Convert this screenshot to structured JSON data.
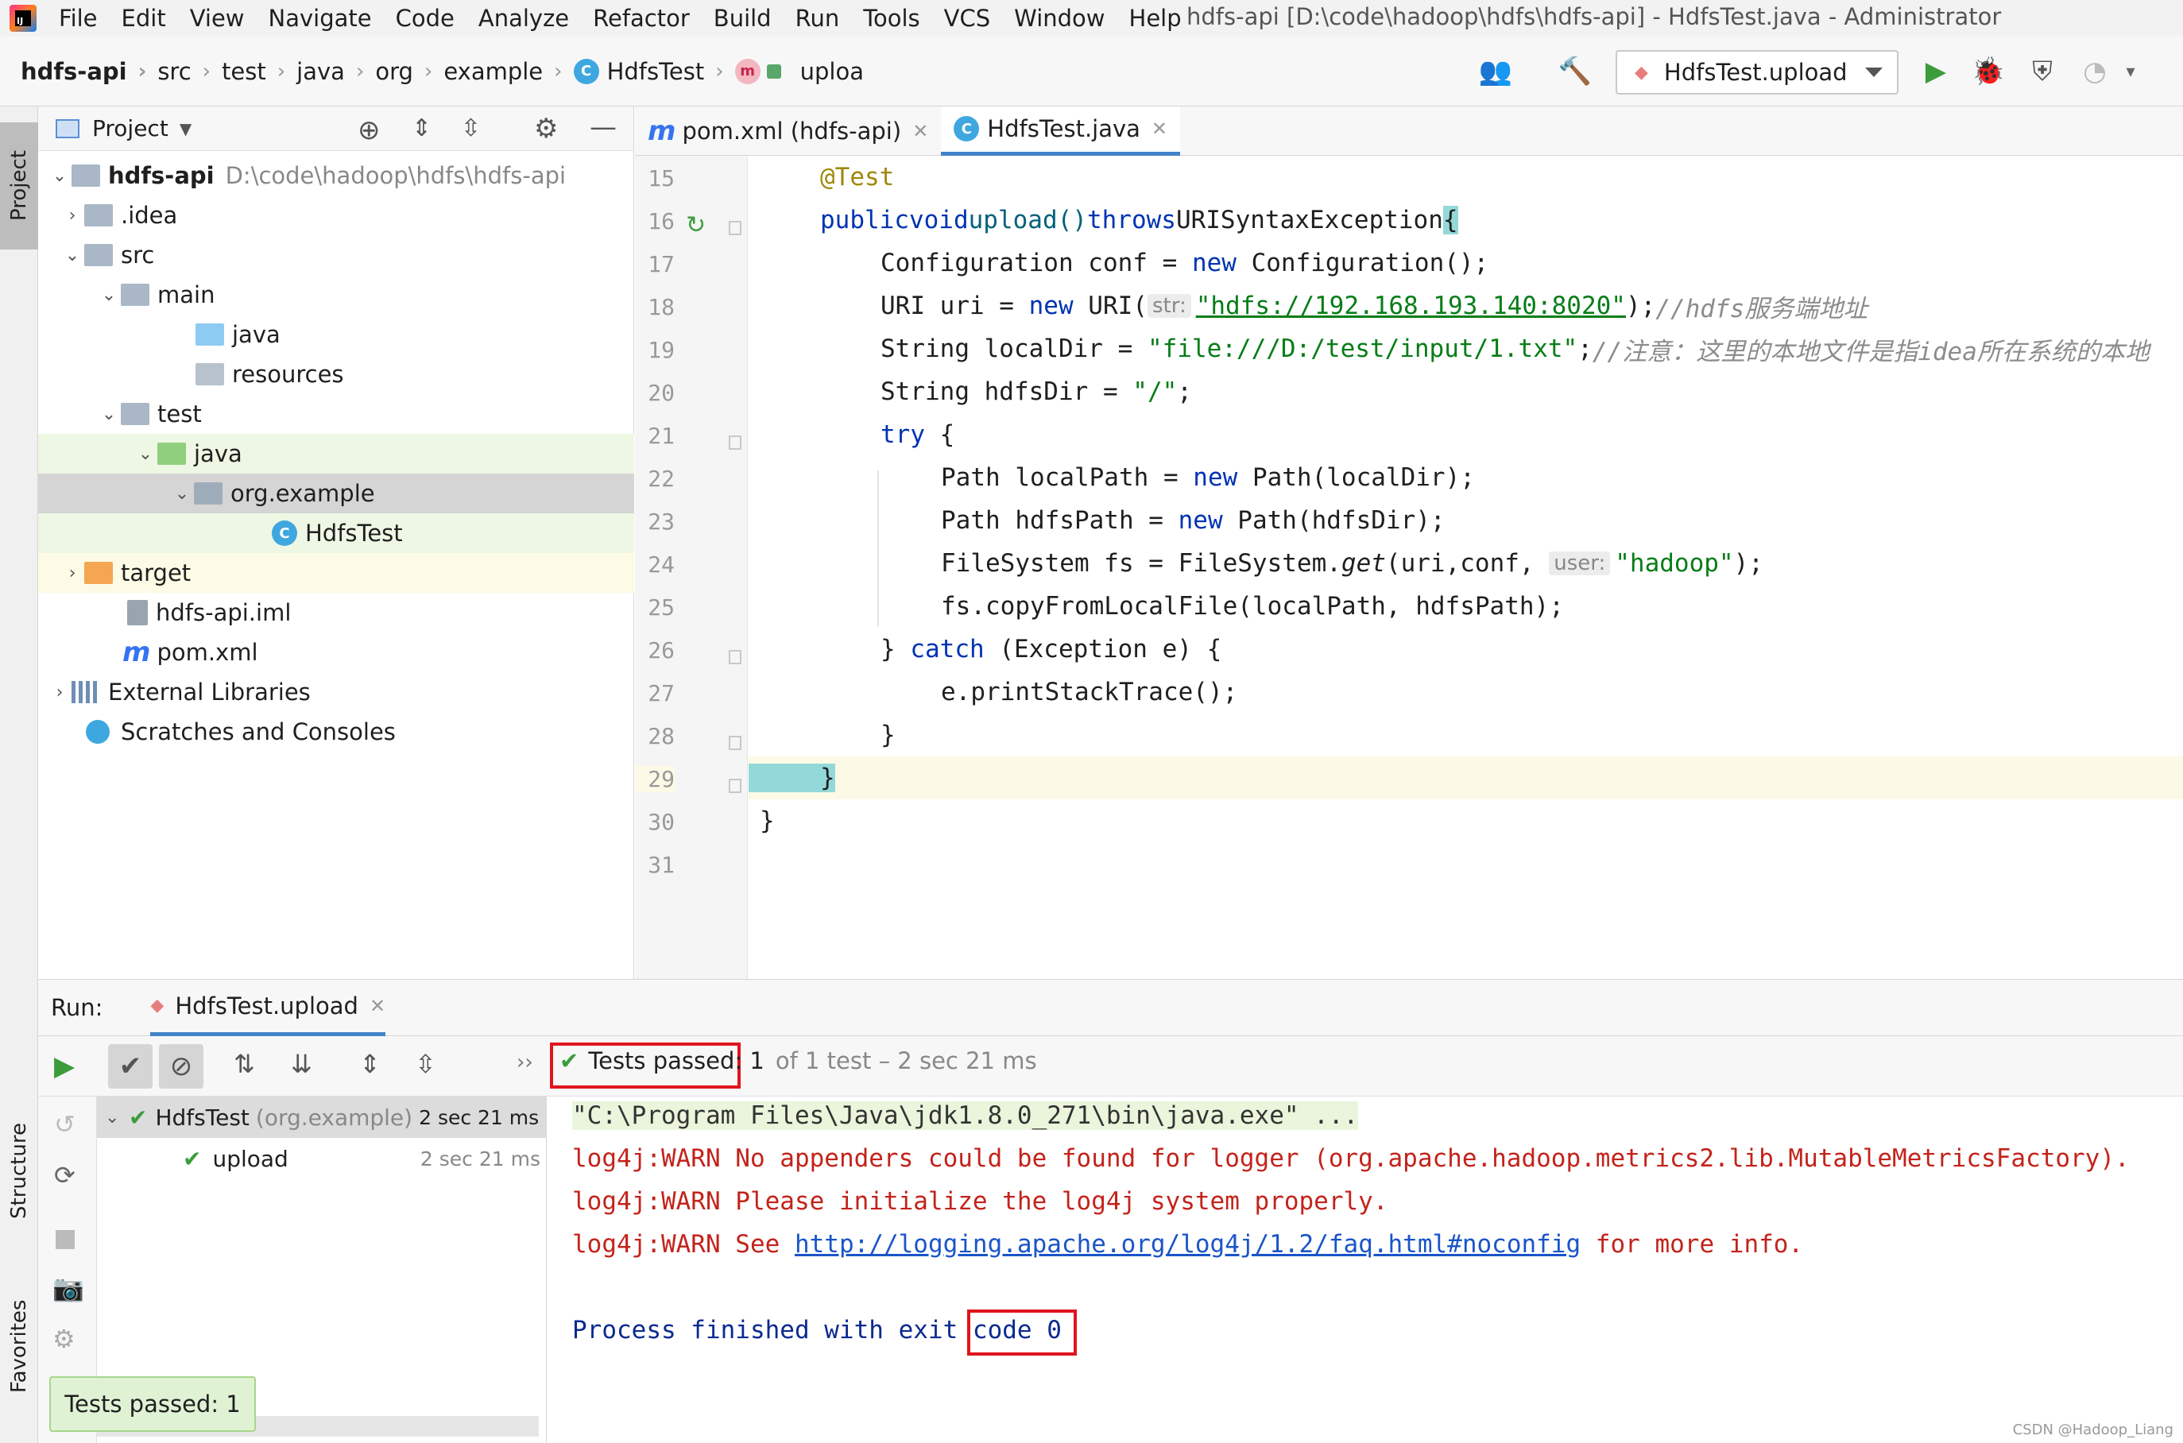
{
  "window": {
    "title": "hdfs-api [D:\\code\\hadoop\\hdfs\\hdfs-api] - HdfsTest.java - Administrator"
  },
  "menu": [
    "File",
    "Edit",
    "View",
    "Navigate",
    "Code",
    "Analyze",
    "Refactor",
    "Build",
    "Run",
    "Tools",
    "VCS",
    "Window",
    "Help"
  ],
  "breadcrumbs": [
    "hdfs-api",
    "src",
    "test",
    "java",
    "org",
    "example",
    "HdfsTest",
    "uploa"
  ],
  "run_config": "HdfsTest.upload",
  "project": {
    "header": "Project",
    "tree": [
      {
        "label": "hdfs-api",
        "path": "D:\\code\\hadoop\\hdfs\\hdfs-api"
      },
      {
        "label": ".idea"
      },
      {
        "label": "src"
      },
      {
        "label": "main"
      },
      {
        "label": "java"
      },
      {
        "label": "resources"
      },
      {
        "label": "test"
      },
      {
        "label": "java"
      },
      {
        "label": "org.example"
      },
      {
        "label": "HdfsTest"
      },
      {
        "label": "target"
      },
      {
        "label": "hdfs-api.iml"
      },
      {
        "label": "pom.xml"
      },
      {
        "label": "External Libraries"
      },
      {
        "label": "Scratches and Consoles"
      }
    ]
  },
  "tabs": [
    {
      "label": "pom.xml (hdfs-api)"
    },
    {
      "label": "HdfsTest.java"
    }
  ],
  "code": {
    "line_numbers": [
      "15",
      "16",
      "17",
      "18",
      "19",
      "20",
      "21",
      "22",
      "23",
      "24",
      "25",
      "26",
      "27",
      "28",
      "29",
      "30",
      "31"
    ],
    "l15": "@Test",
    "l16_kw1": "public",
    "l16_kw2": "void",
    "l16_name": "upload()",
    "l16_kw3": "throws",
    "l16_rest": "URISyntaxException",
    "l16_brace": "{",
    "l17_a": "Configuration conf = ",
    "l17_kw": "new",
    "l17_b": " Configuration();",
    "l18_a": "URI uri = ",
    "l18_kw": "new",
    "l18_b": " URI(",
    "l18_hint": "str:",
    "l18_str": "\"hdfs://192.168.193.140:8020\"",
    "l18_c": ");",
    "l18_cm": "//hdfs服务端地址",
    "l19_a": "String localDir = ",
    "l19_str": "\"file:///D:/test/input/1.txt\"",
    "l19_c": ";",
    "l19_cm": "//注意：这里的本地文件是指idea所在系统的本地",
    "l20_a": "String hdfsDir = ",
    "l20_str": "\"/\"",
    "l20_c": ";",
    "l21_kw": "try",
    "l21_b": " {",
    "l22_a": "Path localPath = ",
    "l22_kw": "new",
    "l22_b": " Path(localDir);",
    "l23_a": "Path hdfsPath = ",
    "l23_kw": "new",
    "l23_b": " Path(hdfsDir);",
    "l24_a": "FileSystem fs = FileSystem.",
    "l24_fn": "get",
    "l24_b": "(uri,conf, ",
    "l24_hint": "user:",
    "l24_str": "\"hadoop\"",
    "l24_c": ");",
    "l25": "fs.copyFromLocalFile(localPath, hdfsPath);",
    "l26_a": "} ",
    "l26_kw": "catch",
    "l26_b": " (Exception e) {",
    "l27": "e.printStackTrace();",
    "l28": "}",
    "l29": "}",
    "l30": "}"
  },
  "run": {
    "label": "Run:",
    "tab": "HdfsTest.upload",
    "status_passed": "Tests passed: 1",
    "status_rest": "of 1 test – 2 sec 21 ms",
    "tests": [
      {
        "name": "HdfsTest",
        "pkg": "(org.example)",
        "time": "2 sec 21 ms"
      },
      {
        "name": "upload",
        "time": "2 sec 21 ms"
      }
    ],
    "console": {
      "cmd": "\"C:\\Program Files\\Java\\jdk1.8.0_271\\bin\\java.exe\" ...",
      "warn1": "log4j:WARN No appenders could be found for logger (org.apache.hadoop.metrics2.lib.MutableMetricsFactory).",
      "warn2": "log4j:WARN Please initialize the log4j system properly.",
      "warn3_a": "log4j:WARN See ",
      "warn3_link": "http://logging.apache.org/log4j/1.2/faq.html#noconfig",
      "warn3_b": " for more info.",
      "finish_a": "Process finished with exit",
      "finish_b": " code 0"
    }
  },
  "sidebar_tabs": {
    "project": "Project",
    "structure": "Structure",
    "favorites": "Favorites"
  },
  "toast": "Tests passed: 1",
  "watermark": "CSDN @Hadoop_Liang",
  "colors": {
    "accent": "#4083c9",
    "pass": "#3c9c3c",
    "highlight_box": "#e0141e"
  }
}
